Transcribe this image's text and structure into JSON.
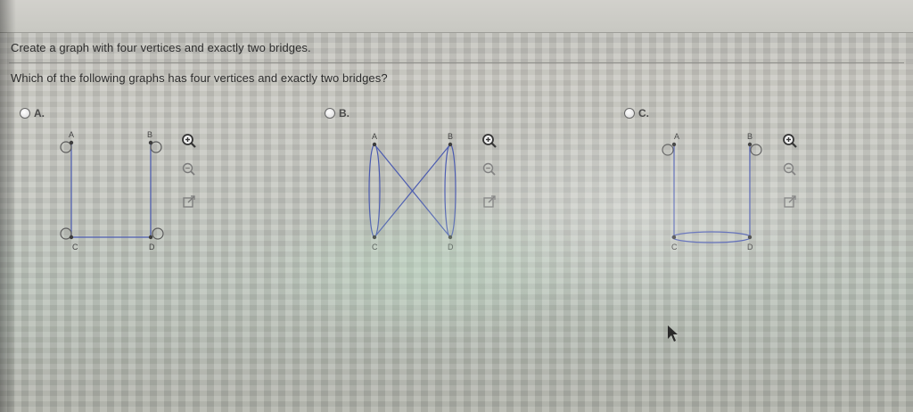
{
  "question": {
    "instruction": "Create a graph with four vertices and exactly two bridges.",
    "prompt": "Which of the following graphs has four vertices and exactly two bridges?"
  },
  "choices": [
    {
      "letter": "A.",
      "vertices": [
        "A",
        "B",
        "C",
        "D"
      ],
      "edges": [
        "A-C",
        "C-D",
        "B-D"
      ],
      "loops": [
        "A",
        "B",
        "C",
        "D"
      ]
    },
    {
      "letter": "B.",
      "vertices": [
        "A",
        "B",
        "C",
        "D"
      ],
      "edges": [
        "A-C",
        "A-C",
        "A-D",
        "B-C",
        "B-D",
        "B-D"
      ],
      "loops": []
    },
    {
      "letter": "C.",
      "vertices": [
        "A",
        "B",
        "C",
        "D"
      ],
      "edges": [
        "A-C",
        "C-D",
        "C-D",
        "B-D"
      ],
      "loops": [
        "A"
      ]
    }
  ],
  "tools": [
    "zoom-in-icon",
    "zoom-out-icon",
    "popout-icon"
  ],
  "colors": {
    "edge": "#4b5bb0",
    "vertex": "#3c3c3c",
    "text": "#2d2d2d",
    "zoom_in_bg": "#f1f1f1"
  }
}
